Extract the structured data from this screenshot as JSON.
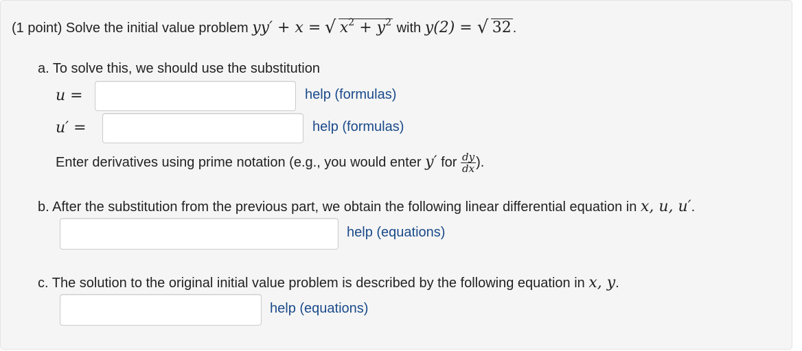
{
  "problem": {
    "prefix": "(1 point) Solve the initial value problem",
    "eq_lhs": "yy′ + x =",
    "eq_radicand_x": "x",
    "eq_radicand_plus": " + ",
    "eq_radicand_y": "y",
    "exp": "2",
    "with_word": "with",
    "ic": "y(2) = ",
    "ic_value": "32",
    "ic_end": "."
  },
  "part_a": {
    "intro": "a. To solve this, we should use the substitution",
    "u_label": "u =",
    "u_value": "",
    "u_help": "help (formulas)",
    "uprime_label": "u′ =",
    "uprime_value": "",
    "uprime_help": "help (formulas)",
    "note_prefix": "Enter derivatives using prime notation (e.g., you would enter",
    "note_yprime": "y′",
    "note_for": "for",
    "frac_num": "dy",
    "frac_den": "dx",
    "note_end": ")."
  },
  "part_b": {
    "intro": "b. After the substitution from the previous part, we obtain the following linear differential equation in",
    "vars": "x, u, u′",
    "end": ".",
    "value": "",
    "help": "help (equations)"
  },
  "part_c": {
    "intro": "c. The solution to the original initial value problem is described by the following equation in",
    "vars": "x, y",
    "end": ".",
    "value": "",
    "help": "help (equations)"
  },
  "colors": {
    "panel_bg": "#f5f5f5",
    "link": "#1a4a8a",
    "text": "#222222"
  }
}
